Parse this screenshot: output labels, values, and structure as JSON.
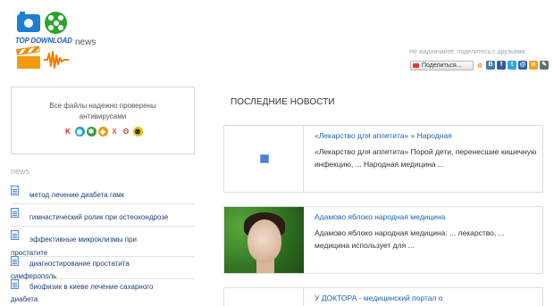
{
  "header": {
    "brand": "TOP DOWNLOAD",
    "site_label": "news"
  },
  "share": {
    "prompt": "Не жадничайте, поделитесь с друзьями:",
    "button_label": "Поделиться..."
  },
  "antivirus": {
    "text": "Все файлы надежно проверены антивирусами"
  },
  "sidebar": {
    "title": "news",
    "items": [
      {
        "label": "метод лечение диабета гамк"
      },
      {
        "label": "гимнастический ролик при остеохондрозе"
      },
      {
        "label": "эффективные микроклизмы при"
      },
      {
        "label": "простатите"
      },
      {
        "label": "диагностирование простатита"
      },
      {
        "label": "симферополь"
      },
      {
        "label": "биофизик в киеве лечение сахарного"
      },
      {
        "label": "диабета"
      }
    ]
  },
  "main": {
    "title": "ПОСЛЕДНИЕ НОВОСТИ",
    "articles": [
      {
        "title": "«Лекарство для аппетита» » Народная",
        "description": "«Лекарство для аппетита» Порой дети, перенесшие кишечную инфекцию, ... Народная медицина ..."
      },
      {
        "title": "Адамово яблоко народная медицина",
        "description": "Адамово яблоко народная медицина: ... лекарство, ... медицина использует для ..."
      },
      {
        "title": "У ДОКТОРА - медицинский портал о",
        "description": ""
      }
    ]
  },
  "colors": {
    "link": "#1b63b5",
    "sidebar_link": "#1c3f7a",
    "muted": "#a7b0b8"
  }
}
